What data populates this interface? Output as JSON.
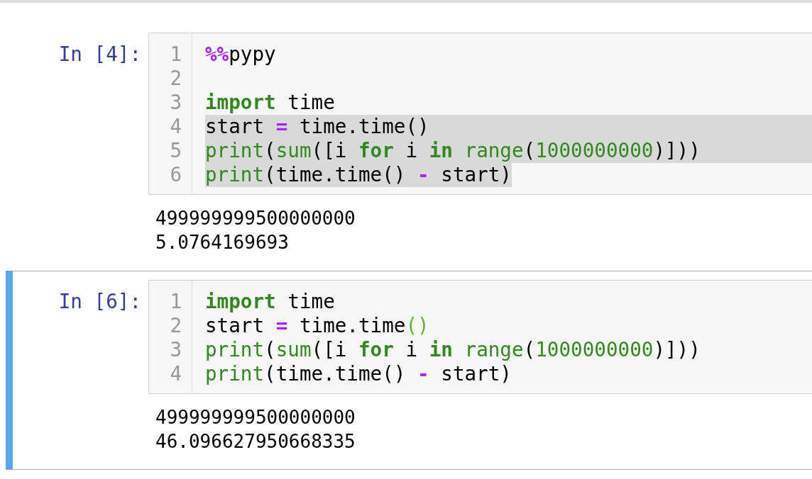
{
  "cells": [
    {
      "prompt": "In [4]:",
      "selected": false,
      "lines": [
        {
          "number": "1",
          "selected": false,
          "tokens": [
            {
              "text": "%%",
              "kind": "operator"
            },
            {
              "text": "pypy",
              "kind": "plain"
            }
          ]
        },
        {
          "number": "2"
        },
        {
          "number": "3",
          "selected": false,
          "tokens": [
            {
              "text": "import",
              "kind": "keyword"
            },
            {
              "text": " time",
              "kind": "plain"
            }
          ]
        },
        {
          "number": "4",
          "selected": true,
          "tokens": [
            {
              "text": "start ",
              "kind": "plain"
            },
            {
              "text": "=",
              "kind": "operator"
            },
            {
              "text": " time.time()",
              "kind": "plain"
            }
          ]
        },
        {
          "number": "5",
          "selected": true,
          "tokens": [
            {
              "text": "print",
              "kind": "builtin"
            },
            {
              "text": "(",
              "kind": "plain"
            },
            {
              "text": "sum",
              "kind": "builtin"
            },
            {
              "text": "([i ",
              "kind": "plain"
            },
            {
              "text": "for",
              "kind": "keyword"
            },
            {
              "text": " i ",
              "kind": "plain"
            },
            {
              "text": "in",
              "kind": "keyword"
            },
            {
              "text": " range",
              "kind": "builtin"
            },
            {
              "text": "(",
              "kind": "plain"
            },
            {
              "text": "1000000000",
              "kind": "number"
            },
            {
              "text": ")]))",
              "kind": "plain"
            }
          ]
        },
        {
          "number": "6",
          "selected": true,
          "tokens": [
            {
              "text": "print",
              "kind": "builtin"
            },
            {
              "text": "(time.time() ",
              "kind": "plain"
            },
            {
              "text": "-",
              "kind": "operator"
            },
            {
              "text": " start)",
              "kind": "plain"
            }
          ]
        }
      ],
      "output": [
        "499999999500000000",
        "5.0764169693"
      ]
    },
    {
      "prompt": "In [6]:",
      "selected": true,
      "lines": [
        {
          "number": "1",
          "selected": false,
          "tokens": [
            {
              "text": "import",
              "kind": "keyword"
            },
            {
              "text": " time",
              "kind": "plain"
            }
          ]
        },
        {
          "number": "2",
          "selected": false,
          "tokens": [
            {
              "text": "start ",
              "kind": "plain"
            },
            {
              "text": "=",
              "kind": "operator"
            },
            {
              "text": " time.time",
              "kind": "plain"
            },
            {
              "text": "()",
              "kind": "matching_bracket"
            }
          ]
        },
        {
          "number": "3",
          "selected": false,
          "tokens": [
            {
              "text": "print",
              "kind": "builtin"
            },
            {
              "text": "(",
              "kind": "plain"
            },
            {
              "text": "sum",
              "kind": "builtin"
            },
            {
              "text": "([i ",
              "kind": "plain"
            },
            {
              "text": "for",
              "kind": "keyword"
            },
            {
              "text": " i ",
              "kind": "plain"
            },
            {
              "text": "in",
              "kind": "keyword"
            },
            {
              "text": " range",
              "kind": "builtin"
            },
            {
              "text": "(",
              "kind": "plain"
            },
            {
              "text": "1000000000",
              "kind": "number"
            },
            {
              "text": ")]))",
              "kind": "plain"
            }
          ]
        },
        {
          "number": "4",
          "selected": false,
          "tokens": [
            {
              "text": "print",
              "kind": "builtin"
            },
            {
              "text": "(time.time() ",
              "kind": "plain"
            },
            {
              "text": "-",
              "kind": "operator"
            },
            {
              "text": " start)",
              "kind": "plain"
            }
          ]
        }
      ],
      "output": [
        "499999999500000000",
        "46.096627950668335"
      ]
    }
  ]
}
